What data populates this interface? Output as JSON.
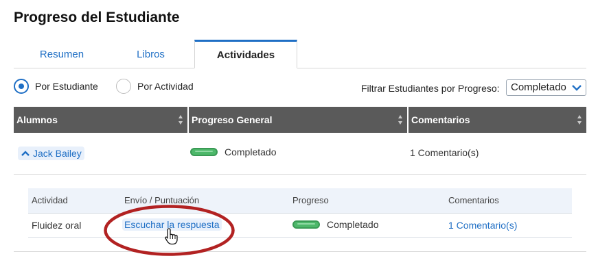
{
  "page": {
    "title": "Progreso del Estudiante"
  },
  "tabs": [
    {
      "label": "Resumen",
      "active": false
    },
    {
      "label": "Libros",
      "active": false
    },
    {
      "label": "Actividades",
      "active": true
    }
  ],
  "view_options": {
    "by_student": {
      "label": "Por Estudiante",
      "selected": true
    },
    "by_activity": {
      "label": "Por Actividad",
      "selected": false
    }
  },
  "filter": {
    "label": "Filtrar Estudiantes por Progreso:",
    "value": "Completado"
  },
  "table": {
    "headers": [
      "Alumnos",
      "Progreso General",
      "Comentarios"
    ],
    "rows": [
      {
        "student": "Jack Bailey",
        "expanded": true,
        "progress": "Completado",
        "comments": "1 Comentario(s)",
        "activities": {
          "headers": [
            "Actividad",
            "Envío / Puntuación",
            "Progreso",
            "Comentarios"
          ],
          "rows": [
            {
              "activity": "Fluidez oral",
              "submission": "Escuchar la respuesta",
              "progress": "Completado",
              "comments": "1 Comentario(s)"
            }
          ]
        }
      }
    ]
  },
  "colors": {
    "accent": "#1f6fc5",
    "header_bg": "#5a5a5a",
    "progress_green": "#4db86a",
    "annotation": "#b22222"
  },
  "icons": {
    "radio": "radio-icon",
    "dropdown": "chevron-down-icon",
    "sort": "sort-icon",
    "expand": "chevron-up-icon",
    "progress": "progress-pill-icon",
    "cursor": "hand-pointer-icon"
  }
}
